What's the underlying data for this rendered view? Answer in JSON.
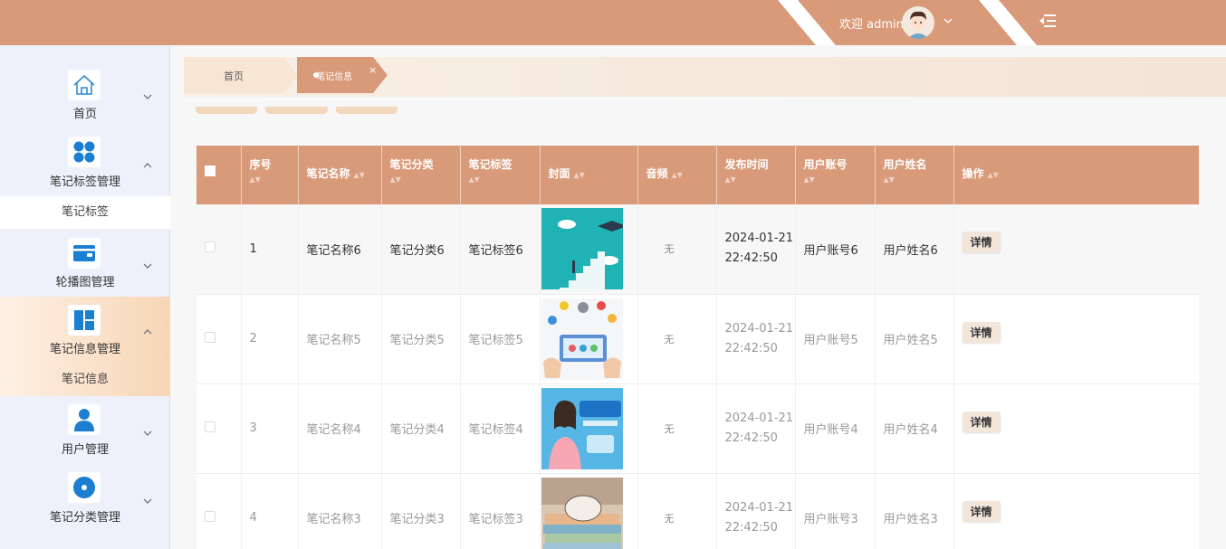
{
  "header": {
    "welcome": "欢迎 admin",
    "accent": "#d99a79"
  },
  "sidebar": {
    "groups": [
      {
        "label": "首页",
        "icon": "home-icon",
        "expanded": false
      },
      {
        "label": "笔记标签管理",
        "icon": "dots-grid-icon",
        "expanded": true,
        "submenu": "笔记标签"
      },
      {
        "label": "轮播图管理",
        "icon": "wallet-icon",
        "expanded": false
      },
      {
        "label": "笔记信息管理",
        "icon": "layout-icon",
        "expanded": true,
        "active": true,
        "submenu": "笔记信息"
      },
      {
        "label": "用户管理",
        "icon": "user-icon",
        "expanded": false
      },
      {
        "label": "笔记分类管理",
        "icon": "disc-icon",
        "expanded": false
      }
    ]
  },
  "tabs": {
    "home": "首页",
    "active": "笔记信息"
  },
  "table": {
    "columns": [
      "序号",
      "笔记名称",
      "笔记分类",
      "笔记标签",
      "封面",
      "音频",
      "发布时间",
      "用户账号",
      "用户姓名",
      "操作"
    ],
    "rows": [
      {
        "no": "1",
        "name": "笔记名称6",
        "category": "笔记分类6",
        "tag": "笔记标签6",
        "audio": "无",
        "date": "2024-01-21",
        "time": "22:42:50",
        "account": "用户账号6",
        "username": "用户姓名6",
        "action": "详情"
      },
      {
        "no": "2",
        "name": "笔记名称5",
        "category": "笔记分类5",
        "tag": "笔记标签5",
        "audio": "无",
        "date": "2024-01-21",
        "time": "22:42:50",
        "account": "用户账号5",
        "username": "用户姓名5",
        "action": "详情"
      },
      {
        "no": "3",
        "name": "笔记名称4",
        "category": "笔记分类4",
        "tag": "笔记标签4",
        "audio": "无",
        "date": "2024-01-21",
        "time": "22:42:50",
        "account": "用户账号4",
        "username": "用户姓名4",
        "action": "详情"
      },
      {
        "no": "4",
        "name": "笔记名称3",
        "category": "笔记分类3",
        "tag": "笔记标签3",
        "audio": "无",
        "date": "2024-01-21",
        "time": "22:42:50",
        "account": "用户账号3",
        "username": "用户姓名3",
        "action": "详情"
      }
    ]
  }
}
